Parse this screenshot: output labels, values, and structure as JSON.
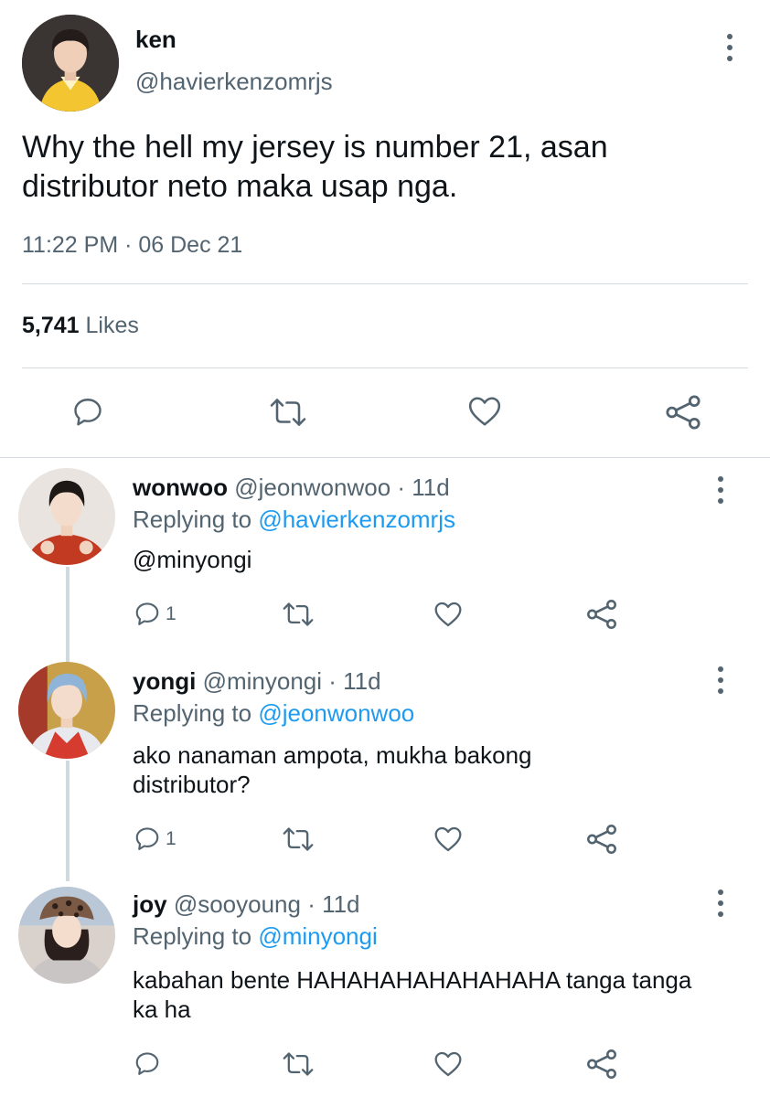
{
  "main_tweet": {
    "display_name": "ken",
    "handle": "@havierkenzomrjs",
    "text": "Why the hell my jersey is number 21, asan distributor neto maka usap nga.",
    "timestamp": "11:22 PM · 06 Dec 21",
    "likes_count": "5,741",
    "likes_label": "Likes"
  },
  "replies": [
    {
      "display_name": "wonwoo",
      "meta": "@jeonwonwoo · 11d",
      "replying_prefix": "Replying to ",
      "replying_to": "@havierkenzomrjs",
      "text": "@minyongi",
      "reply_count": "1"
    },
    {
      "display_name": "yongi",
      "meta": "@minyongi · 11d",
      "replying_prefix": "Replying to ",
      "replying_to": "@jeonwonwoo",
      "text": "ako nanaman ampota, mukha bakong distributor?",
      "reply_count": "1"
    },
    {
      "display_name": "joy",
      "meta": "@sooyoung · 11d",
      "replying_prefix": "Replying to ",
      "replying_to": "@minyongi",
      "text": "kabahan bente HAHAHAHAHAHAHAHA tanga tanga ka ha",
      "reply_count": ""
    }
  ],
  "icons": {
    "reply": "reply-icon",
    "retweet": "retweet-icon",
    "like": "heart-icon",
    "share": "share-icon",
    "more": "more-vertical-icon"
  },
  "colors": {
    "text": "#0f1419",
    "secondary": "#536471",
    "link": "#1d9bf0",
    "divider": "#d6dce1",
    "thread_line": "#cfd9de"
  }
}
